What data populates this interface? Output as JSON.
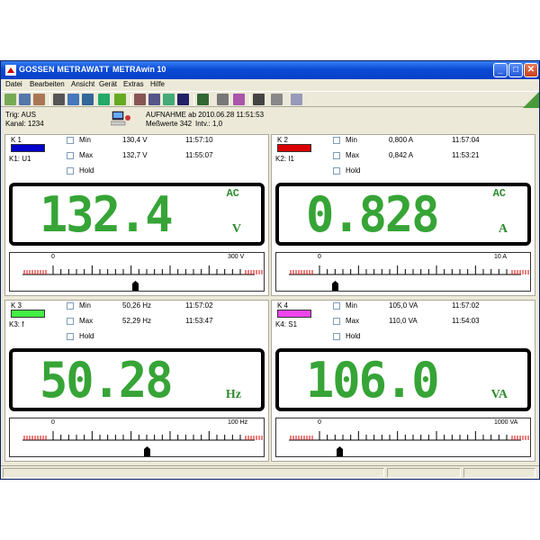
{
  "window": {
    "brand": "GOSSEN METRAWATT",
    "title": "METRAwin 10",
    "minimize": "_",
    "maximize": "□",
    "close": "✕"
  },
  "menu": [
    "Datei",
    "Bearbeiten",
    "Ansicht",
    "Gerät",
    "Extras",
    "Hilfe"
  ],
  "toolbar_icons": [
    "open-icon",
    "save-icon",
    "print-setup-icon",
    "record-icon",
    "play-icon",
    "device-icon",
    "chart-icon",
    "table-icon",
    "export-icon",
    "settings-icon",
    "list-icon",
    "monitor-icon",
    "wave-icon",
    "scale-icon",
    "filter-icon",
    "print-icon",
    "zoom-icon",
    "help-icon"
  ],
  "info": {
    "trig": "Trig: AUS",
    "kanal": "Kanal: 1234",
    "aufnahme": "AUFNAHME ab 2010.06.28 11:51:53",
    "messwerte": "Meßwerte 342",
    "intv": "Intv.: 1,0"
  },
  "accent": {
    "lcd_green": "#36a436",
    "title_blue": "#0a4bd6"
  },
  "channels": [
    {
      "label": "K 1",
      "sub": "K1: U1",
      "color": "#0000cc",
      "min_label": "Min",
      "max_label": "Max",
      "hold_label": "Hold",
      "min_value": "130,4  V",
      "min_time": "11:57:10",
      "max_value": "132,7  V",
      "max_time": "11:55:07",
      "ac": "AC",
      "reading": "132.4",
      "unit": "V",
      "scale_start": "0",
      "scale_end": "300 V",
      "pointer_fraction": 0.441
    },
    {
      "label": "K 2",
      "sub": "K2: I1",
      "color": "#dd0000",
      "min_label": "Min",
      "max_label": "Max",
      "hold_label": "Hold",
      "min_value": "0,800  A",
      "min_time": "11:57:04",
      "max_value": "0,842  A",
      "max_time": "11:53:21",
      "ac": "AC",
      "reading": "0.828",
      "unit": "A",
      "scale_start": "0",
      "scale_end": "10 A",
      "pointer_fraction": 0.083
    },
    {
      "label": "K 3",
      "sub": "K3: f",
      "color": "#44ee44",
      "min_label": "Min",
      "max_label": "Max",
      "hold_label": "Hold",
      "min_value": "50,26  Hz",
      "min_time": "11:57:02",
      "max_value": "52,29  Hz",
      "max_time": "11:53:47",
      "ac": "",
      "reading": "50.28",
      "unit": "Hz",
      "scale_start": "0",
      "scale_end": "100 Hz",
      "pointer_fraction": 0.503
    },
    {
      "label": "K 4",
      "sub": "K4: S1",
      "color": "#ee44ee",
      "min_label": "Min",
      "max_label": "Max",
      "hold_label": "Hold",
      "min_value": "105,0  VA",
      "min_time": "11:57:02",
      "max_value": "110,0  VA",
      "max_time": "11:54:03",
      "ac": "",
      "reading": "106.0",
      "unit": "VA",
      "scale_start": "0",
      "scale_end": "1000 VA",
      "pointer_fraction": 0.106
    }
  ]
}
